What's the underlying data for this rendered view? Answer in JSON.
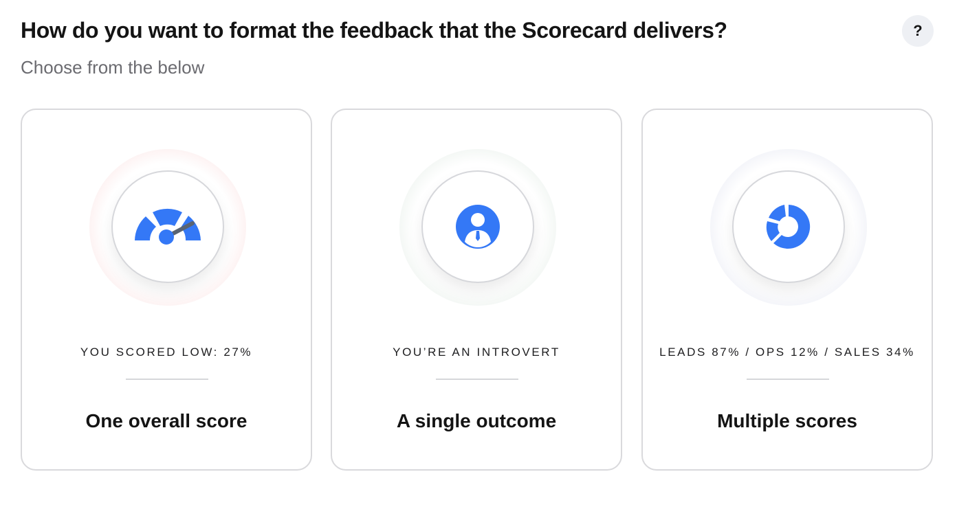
{
  "header": {
    "title": "How do you want to format the feedback that the Scorecard delivers?",
    "subtitle": "Choose from the below",
    "help_label": "?"
  },
  "options": [
    {
      "caption": "YOU SCORED LOW: 27%",
      "label": "One overall score",
      "icon": "gauge-icon"
    },
    {
      "caption": "YOU’RE AN INTROVERT",
      "label": "A single outcome",
      "icon": "person-icon"
    },
    {
      "caption": "LEADS 87% / OPS 12% / SALES 34%",
      "label": "Multiple scores",
      "icon": "donut-chart-icon"
    }
  ],
  "colors": {
    "accent": "#3478f6",
    "needle": "#5a6472",
    "card_border": "#d9d9dc"
  }
}
